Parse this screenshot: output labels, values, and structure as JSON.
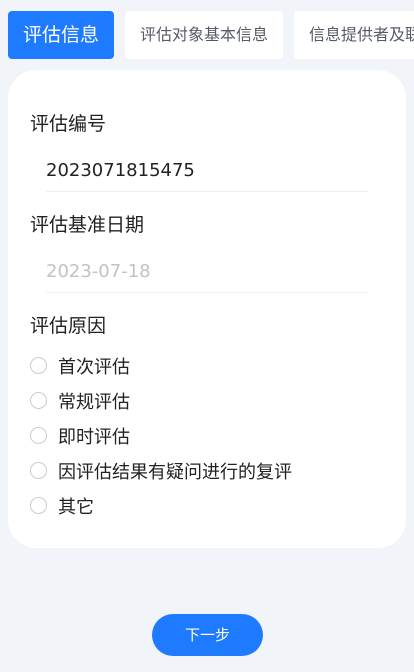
{
  "tabs": [
    {
      "label": "评估信息",
      "active": true
    },
    {
      "label": "评估对象基本信息",
      "active": false
    },
    {
      "label": "信息提供者及联",
      "active": false
    }
  ],
  "form": {
    "assessment_number": {
      "label": "评估编号",
      "value": "2023071815475"
    },
    "base_date": {
      "label": "评估基准日期",
      "value": "2023-07-18"
    },
    "reason": {
      "label": "评估原因",
      "options": [
        "首次评估",
        "常规评估",
        "即时评估",
        "因评估结果有疑问进行的复评",
        "其它"
      ]
    }
  },
  "footer": {
    "next_label": "下一步"
  },
  "colors": {
    "accent": "#1e7bff",
    "background": "#f1f4f9"
  }
}
